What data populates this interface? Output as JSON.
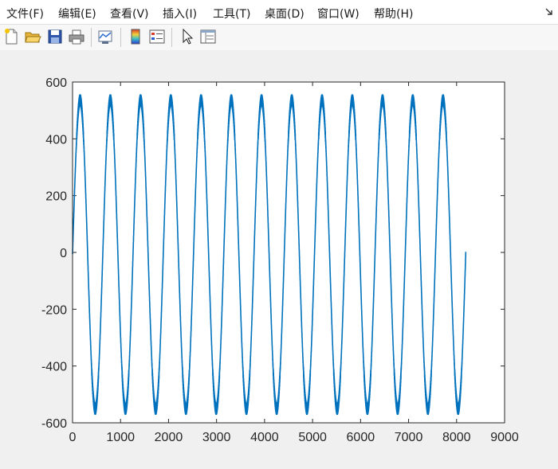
{
  "menu": [
    "文件(F)",
    "编辑(E)",
    "查看(V)",
    "插入(I)",
    "工具(T)",
    "桌面(D)",
    "窗口(W)",
    "帮助(H)"
  ],
  "menu_corner_icon": "dock-arrow-icon",
  "toolbar": {
    "buttons": [
      "new-figure-icon",
      "open-file-icon",
      "save-icon",
      "print-icon",
      "link-plot-icon",
      "colorbar-icon",
      "legend-icon",
      "select-pointer-icon",
      "property-inspector-icon"
    ]
  },
  "colors": {
    "line": "#0072bd",
    "axes_bg": "#ffffff",
    "figure_bg": "#f0f0f0",
    "axis": "#262626"
  },
  "chart_data": {
    "type": "line",
    "title": "",
    "xlabel": "",
    "ylabel": "",
    "xlim": [
      0,
      9000
    ],
    "ylim": [
      -600,
      600
    ],
    "xticks": [
      0,
      1000,
      2000,
      3000,
      4000,
      5000,
      6000,
      7000,
      8000,
      9000
    ],
    "yticks": [
      -600,
      -400,
      -200,
      0,
      200,
      400,
      600
    ],
    "xtick_labels": [
      "0",
      "1000",
      "2000",
      "3000",
      "4000",
      "5000",
      "6000",
      "7000",
      "8000",
      "9000"
    ],
    "ytick_labels": [
      "-600",
      "-400",
      "-200",
      "0",
      "200",
      "400",
      "600"
    ],
    "grid": false,
    "box": true,
    "series": [
      {
        "x_start": 1,
        "x_end": 8192,
        "period": 630,
        "amplitude_max": 537,
        "amplitude_min": -552,
        "ripple": 40
      }
    ]
  }
}
